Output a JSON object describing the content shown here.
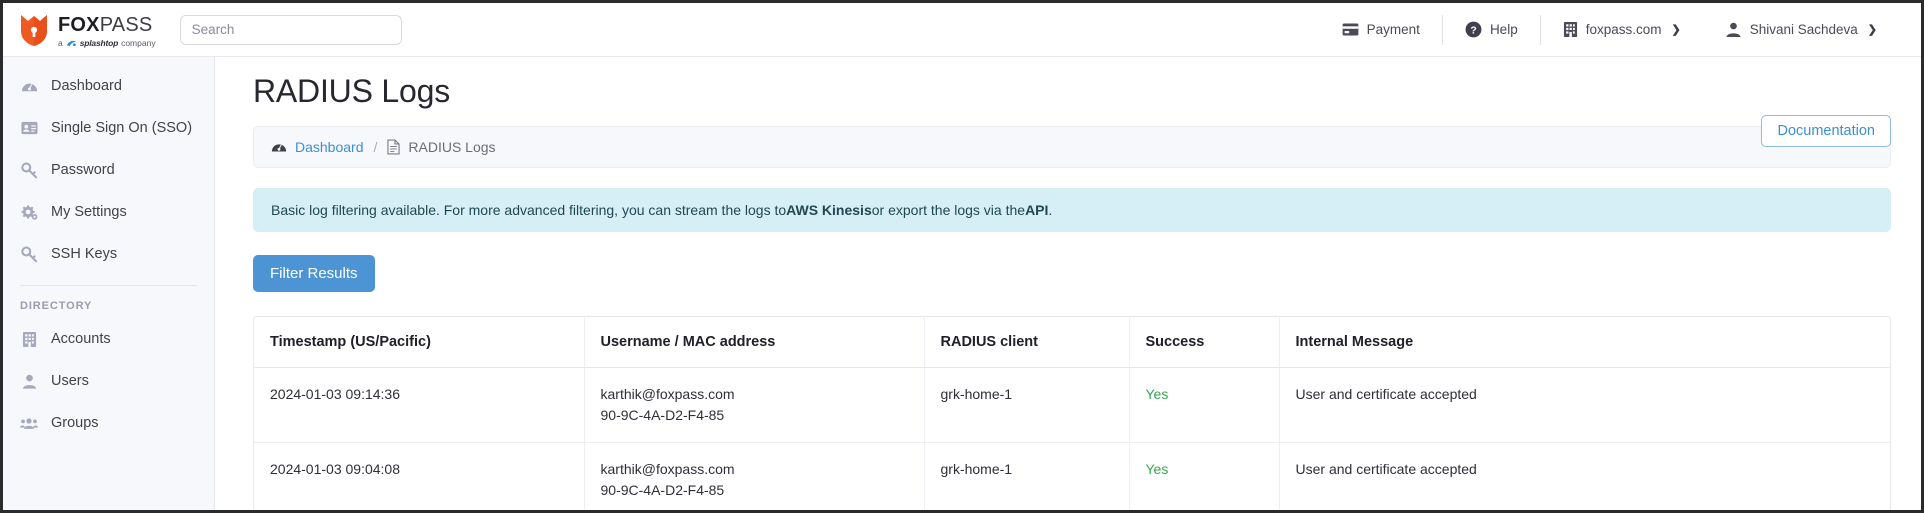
{
  "brand": {
    "name_bold": "FOX",
    "name_light": "PASS",
    "tagline_prefix": "a",
    "tagline_brand": "splashtop",
    "tagline_suffix": "company",
    "logo_color": "#f05a22"
  },
  "search": {
    "placeholder": "Search",
    "value": ""
  },
  "topnav": {
    "items": [
      {
        "label": "Payment",
        "icon": "credit-card-icon",
        "chevron": ""
      },
      {
        "label": "Help",
        "icon": "question-circle-icon",
        "chevron": ""
      },
      {
        "label": "foxpass.com",
        "icon": "building-icon",
        "chevron": "❯"
      },
      {
        "label": "Shivani Sachdeva",
        "icon": "user-icon",
        "chevron": "❯"
      }
    ]
  },
  "sidebar": {
    "items": [
      {
        "label": "Dashboard",
        "icon": "speedometer-icon"
      },
      {
        "label": "Single Sign On (SSO)",
        "icon": "id-card-icon"
      },
      {
        "label": "Password",
        "icon": "key-icon"
      },
      {
        "label": "My Settings",
        "icon": "gears-icon"
      },
      {
        "label": "SSH Keys",
        "icon": "key-icon"
      }
    ],
    "section_label": "DIRECTORY",
    "directory_items": [
      {
        "label": "Accounts",
        "icon": "building-icon"
      },
      {
        "label": "Users",
        "icon": "user-icon"
      },
      {
        "label": "Groups",
        "icon": "users-group-icon"
      }
    ]
  },
  "page": {
    "title": "RADIUS Logs",
    "documentation_label": "Documentation",
    "breadcrumb": {
      "home_label": "Dashboard",
      "separator": "/",
      "current_label": "RADIUS Logs"
    },
    "alert": {
      "text_1": "Basic log filtering available. For more advanced filtering, you can stream the logs to ",
      "bold_1": "AWS Kinesis",
      "text_2": " or export the logs via the ",
      "bold_2": "API",
      "text_3": "."
    },
    "filter_button_label": "Filter Results"
  },
  "table": {
    "columns": [
      "Timestamp (US/Pacific)",
      "Username / MAC address",
      "RADIUS client",
      "Success",
      "Internal Message"
    ],
    "rows": [
      {
        "timestamp": "2024-01-03 09:14:36",
        "username": "karthik@foxpass.com",
        "mac": "90-9C-4A-D2-F4-85",
        "client": "grk-home-1",
        "success": "Yes",
        "message": "User and certificate accepted"
      },
      {
        "timestamp": "2024-01-03 09:04:08",
        "username": "karthik@foxpass.com",
        "mac": "90-9C-4A-D2-F4-85",
        "client": "grk-home-1",
        "success": "Yes",
        "message": "User and certificate accepted"
      }
    ]
  },
  "colors": {
    "accent_blue": "#4d94d4",
    "link_blue": "#3b8fd4",
    "success_green": "#3aa652",
    "alert_bg": "#d6eef6"
  }
}
